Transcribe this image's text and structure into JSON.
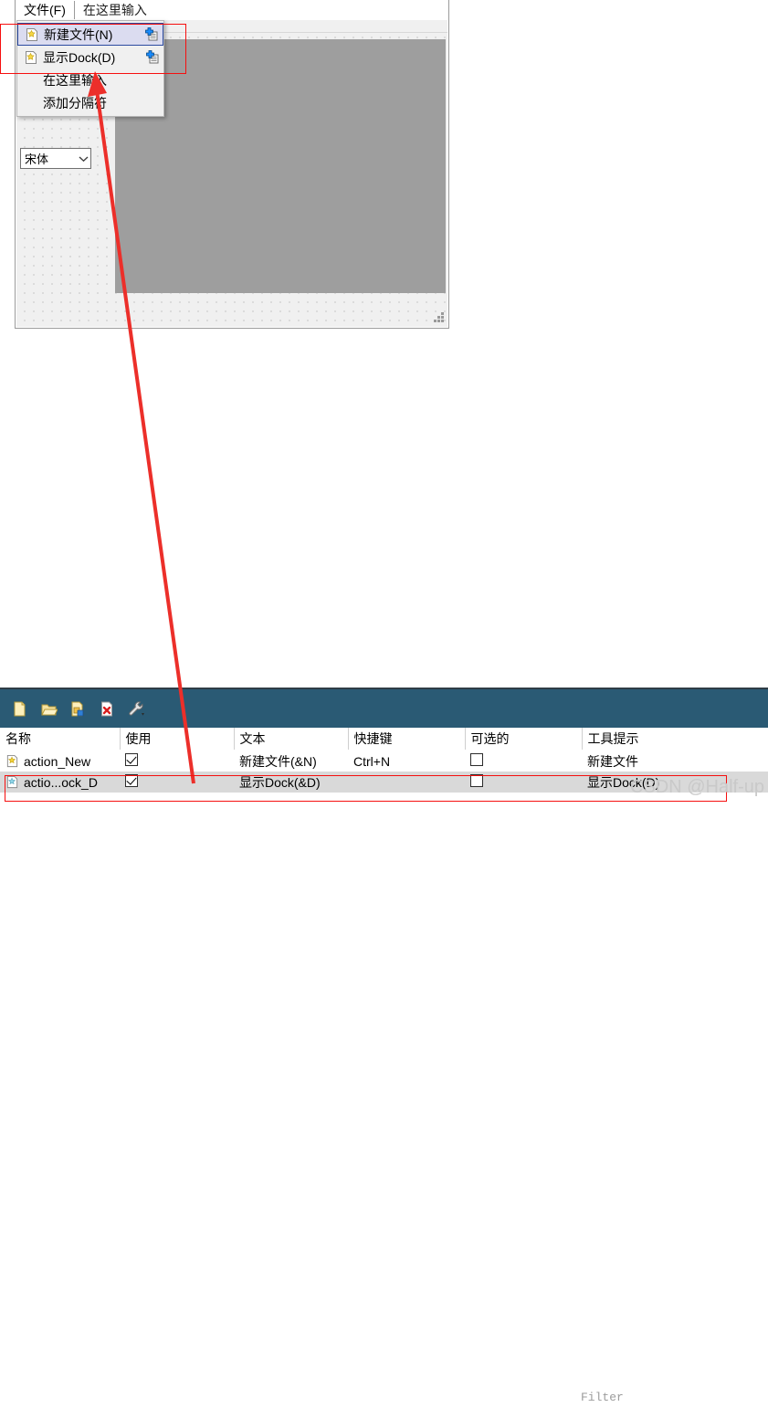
{
  "designer": {
    "menubar": [
      {
        "label": "文件(F)",
        "name": "menubar-item-file"
      },
      {
        "label": "在这里输入",
        "name": "menubar-item-type-here"
      }
    ],
    "popup_menu": {
      "items": [
        {
          "label": "新建文件(N)",
          "icon": "document-star-icon",
          "right_icon": "add-action-icon",
          "selected": true
        },
        {
          "label": "显示Dock(D)",
          "icon": "document-star-icon",
          "right_icon": "add-action-icon",
          "selected": false
        },
        {
          "label": "在这里输入",
          "icon": "",
          "right_icon": "",
          "selected": false
        },
        {
          "label": "添加分隔符",
          "icon": "",
          "right_icon": "",
          "selected": false
        }
      ]
    },
    "font_combo": {
      "value": "宋体",
      "arrow": "chevron-down-icon"
    },
    "dock_widget_label": ""
  },
  "action_editor": {
    "toolbar_buttons": [
      {
        "name": "new-action-button",
        "icon": "new-document-icon"
      },
      {
        "name": "new-action-group-button",
        "icon": "folder-icon"
      },
      {
        "name": "edit-action-button",
        "icon": "edit-action-icon"
      },
      {
        "name": "delete-action-button",
        "icon": "delete-document-icon"
      },
      {
        "name": "configure-button",
        "icon": "wrench-icon"
      }
    ],
    "filter": {
      "placeholder": "Filter",
      "value": ""
    },
    "columns": [
      "名称",
      "使用",
      "文本",
      "快捷键",
      "可选的",
      "工具提示"
    ],
    "rows": [
      {
        "name": "action_New",
        "icon_color": "#f2d23c",
        "used": true,
        "text": "新建文件(&N)",
        "shortcut": "Ctrl+N",
        "checkable": false,
        "tooltip": "新建文件",
        "selected": false
      },
      {
        "name": "actio...ock_D",
        "icon_color": "#8fd6e8",
        "used": true,
        "text": "显示Dock(&D)",
        "shortcut": "",
        "checkable": false,
        "tooltip": "显示Dock(D)",
        "selected": true
      }
    ]
  },
  "annotations": {
    "watermark": "CSDN @Half-up",
    "highlight_color": "#f60f0f",
    "arrow_color": "#ec2f2a"
  }
}
